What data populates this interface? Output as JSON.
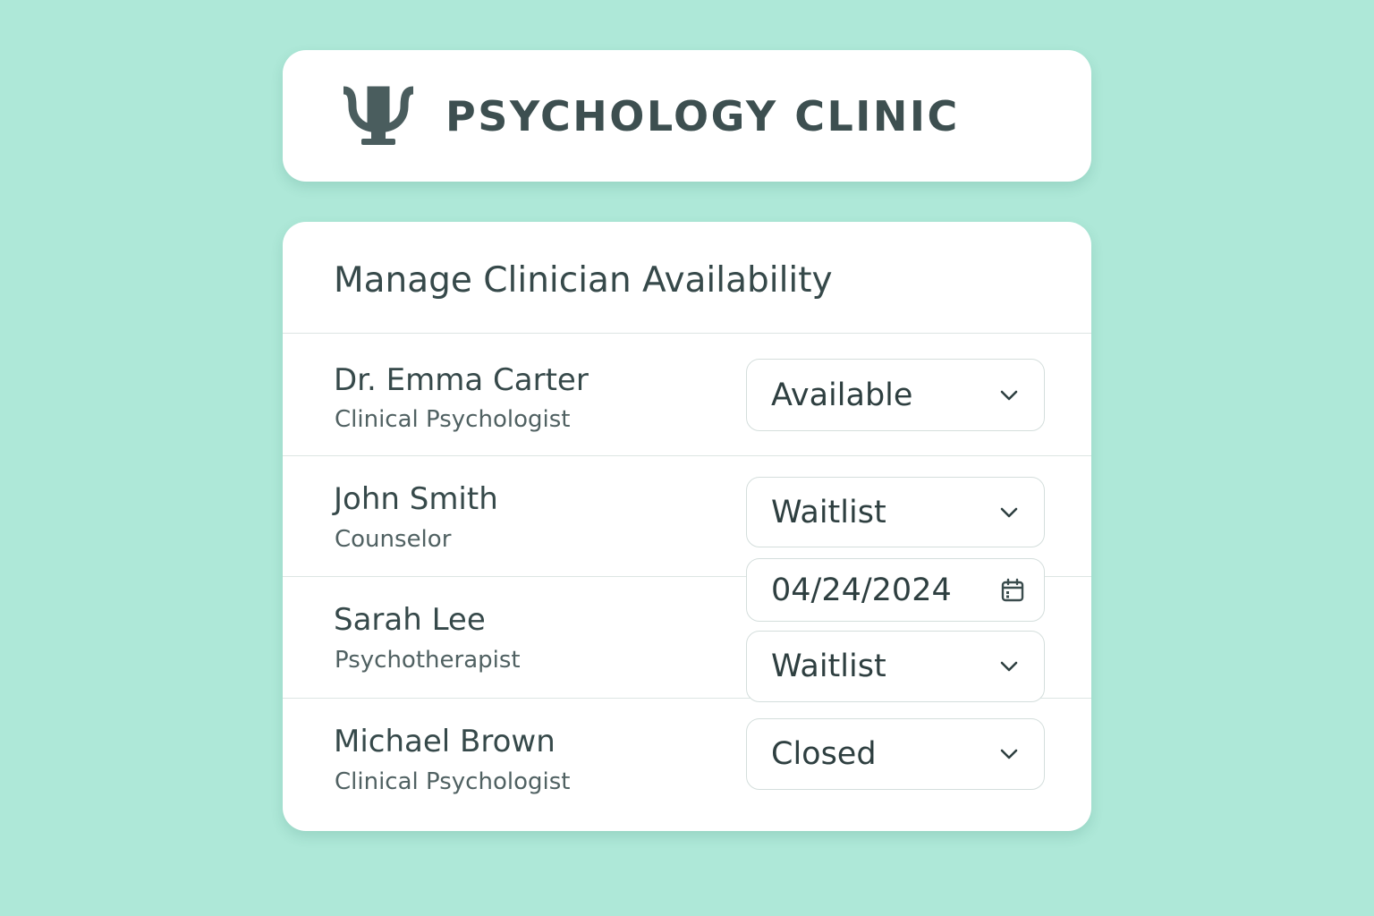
{
  "header": {
    "logo_icon": "psi-icon",
    "clinic_name": "PSYCHOLOGY CLINIC"
  },
  "panel": {
    "title": "Manage Clinician Availability"
  },
  "clinicians": [
    {
      "name": "Dr. Emma Carter",
      "role": "Clinical Psychologist",
      "status": "Available"
    },
    {
      "name": "John Smith",
      "role": "Counselor",
      "status": "Waitlist",
      "date": "04/24/2024"
    },
    {
      "name": "Sarah Lee",
      "role": "Psychotherapist",
      "status": "Waitlist"
    },
    {
      "name": "Michael Brown",
      "role": "Clinical Psychologist",
      "status": "Closed"
    }
  ],
  "colors": {
    "background": "#aee8d8",
    "card": "#ffffff",
    "text": "#36494a",
    "muted_text": "#506162",
    "border": "#d4dedc"
  }
}
